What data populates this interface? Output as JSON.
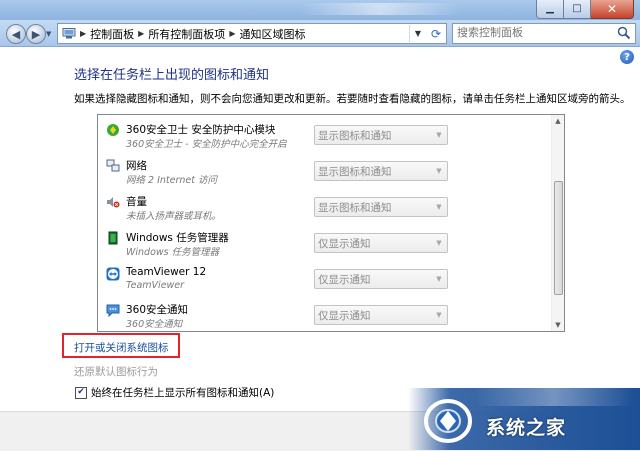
{
  "window": {
    "minimize": "▁",
    "maximize": "□",
    "close": "✕"
  },
  "address": {
    "breadcrumbs": [
      "控制面板",
      "所有控制面板项",
      "通知区域图标"
    ],
    "search_placeholder": "搜索控制面板"
  },
  "icons": {
    "back": "back-arrow-icon",
    "forward": "forward-arrow-icon",
    "refresh": "refresh-icon",
    "search": "magnifier-icon",
    "help": "help-icon"
  },
  "content": {
    "heading": "选择在任务栏上出现的图标和通知",
    "description": "如果选择隐藏图标和通知，则不会向您通知更改和更新。若要随时查看隐藏的图标，请单击任务栏上通知区域旁的箭头。",
    "help_label": "?",
    "items": [
      {
        "name": "360安全卫士 安全防护中心模块",
        "sub": "360安全卫士 - 安全防护中心完全开启",
        "behavior": "显示图标和通知",
        "icon": "360-shield-icon"
      },
      {
        "name": "网络",
        "sub": "网络 2 Internet 访问",
        "behavior": "显示图标和通知",
        "icon": "network-icon"
      },
      {
        "name": "音量",
        "sub": "未插入扬声器或耳机。",
        "behavior": "显示图标和通知",
        "icon": "speaker-muted-icon"
      },
      {
        "name": "Windows 任务管理器",
        "sub": "Windows 任务管理器",
        "behavior": "仅显示通知",
        "icon": "task-manager-icon"
      },
      {
        "name": "TeamViewer 12",
        "sub": "TeamViewer",
        "behavior": "仅显示通知",
        "icon": "teamviewer-icon"
      },
      {
        "name": "360安全通知",
        "sub": "360安全通知",
        "behavior": "仅显示通知",
        "icon": "chat-bubble-icon"
      }
    ],
    "system_icons_link": "打开或关闭系统图标",
    "restore_link": "还原默认图标行为",
    "always_show_label": "始终在任务栏上显示所有图标和通知(A)",
    "always_show_checked": true
  },
  "watermark": {
    "text": "系统之家"
  },
  "colors": {
    "heading": "#1e3287",
    "link": "#1a4ea2",
    "highlight_box": "#e5232a"
  }
}
